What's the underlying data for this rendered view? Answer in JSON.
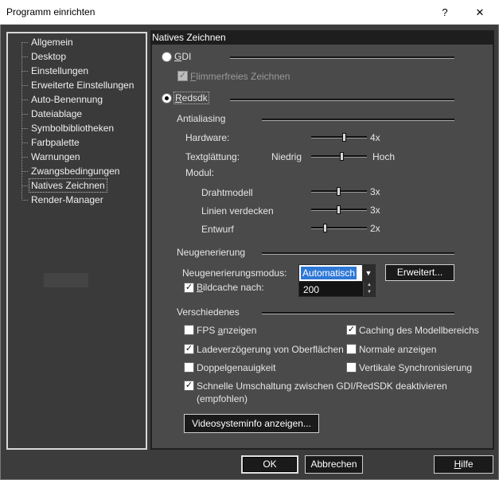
{
  "window": {
    "title": "Programm einrichten",
    "help_glyph": "?",
    "close_glyph": "✕",
    "help_icon": "question-mark-icon",
    "close_icon": "close-icon"
  },
  "tree": {
    "items": [
      {
        "label": "Allgemein"
      },
      {
        "label": "Desktop"
      },
      {
        "label": "Einstellungen"
      },
      {
        "label": "Erweiterte Einstellungen"
      },
      {
        "label": "Auto-Benennung"
      },
      {
        "label": "Dateiablage"
      },
      {
        "label": "Symbolbibliotheken"
      },
      {
        "label": "Farbpalette"
      },
      {
        "label": "Warnungen"
      },
      {
        "label": "Zwangsbedingungen"
      },
      {
        "label": "Natives Zeichnen",
        "selected": true
      },
      {
        "label": "Render-Manager"
      }
    ]
  },
  "panel": {
    "header": "Natives Zeichnen",
    "gdi": {
      "label_first": "G",
      "label_rest": "DI",
      "selected": false
    },
    "flicker": {
      "label_first": "F",
      "label_rest": "limmerfreies Zeichnen",
      "checked": true,
      "enabled": false,
      "check_glyph": "✓"
    },
    "redsdk": {
      "label_first": "R",
      "label_rest": "edsdk",
      "selected": true
    },
    "antialiasing": {
      "title": "Antialiasing",
      "hardware": {
        "label": "Hardware:",
        "value": "4x",
        "level": 0.6
      },
      "smoothing": {
        "label": "Textglättung:",
        "low": "Niedrig",
        "high": "Hoch",
        "level": 0.55
      },
      "module_label": "Modul:",
      "wireframe": {
        "label": "Drahtmodell",
        "value": "3x",
        "level": 0.5
      },
      "hidden_line": {
        "label": "Linien verdecken",
        "value": "3x",
        "level": 0.5
      },
      "draft": {
        "label": "Entwurf",
        "value": "2x",
        "level": 0.25
      }
    },
    "regen": {
      "title": "Neugenerierung",
      "mode_label": "Neugenerierungsmodus:",
      "mode_value": "Automatisch",
      "dropdown_glyph": "▼",
      "advanced_label": "Erweitert...",
      "cache_label_first": "B",
      "cache_label_rest": "ildcache nach:",
      "cache_checked": true,
      "cache_value": "200",
      "spin_up": "▲",
      "spin_down": "▼"
    },
    "misc": {
      "title": "Verschiedenes",
      "check_glyph": "✓",
      "fps": {
        "pre": "FPS ",
        "u": "a",
        "post": "nzeigen",
        "checked": false
      },
      "cache_model": {
        "label": "Caching des Modellbereichs",
        "checked": true
      },
      "load_delay": {
        "label": "Ladeverzögerung von Oberflächen",
        "checked": true
      },
      "normals": {
        "label": "Normale anzeigen",
        "checked": false
      },
      "double_prec": {
        "label": "Doppelgenauigkeit",
        "checked": false
      },
      "vsync": {
        "label": "Vertikale Synchronisierung",
        "checked": false
      },
      "fast_switch": {
        "line1": "Schnelle Umschaltung zwischen GDI/RedSDK deaktivieren",
        "line2": "(empfohlen)",
        "checked": true
      },
      "video_info_label": "Videosysteminfo anzeigen..."
    }
  },
  "footer": {
    "ok_label": "OK",
    "cancel_label": "Abbrechen",
    "help_first": "H",
    "help_rest": "ilfe"
  }
}
